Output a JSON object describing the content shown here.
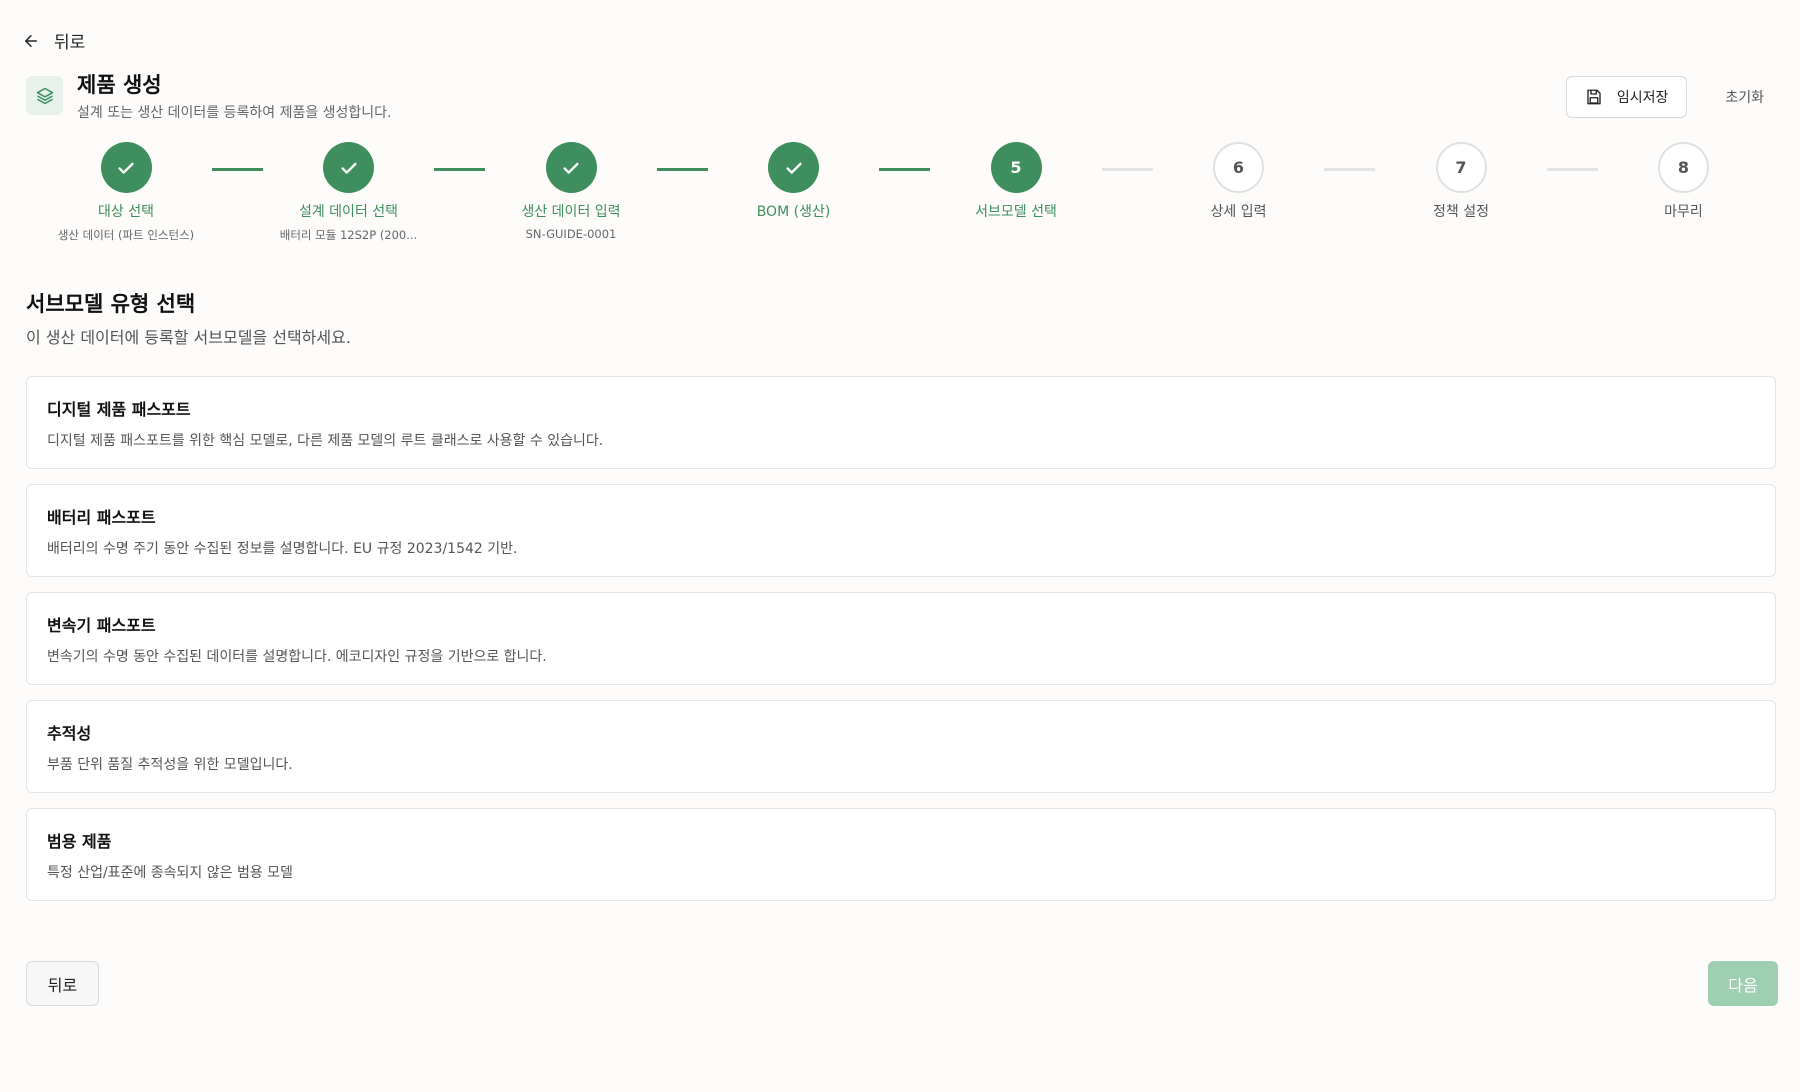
{
  "nav": {
    "back_label": "뒤로"
  },
  "header": {
    "title": "제품 생성",
    "subtitle": "설계 또는 생산 데이터를 등록하여 제품을 생성합니다.",
    "save_label": "임시저장",
    "reset_label": "초기화"
  },
  "colors": {
    "accent": "#3e8e5e",
    "accent_light": "#e8f2ec",
    "disabled_button": "#9fcfb1"
  },
  "stepper": {
    "current_step": 5,
    "steps": [
      {
        "number": "1",
        "label": "대상 선택",
        "sublabel": "생산 데이터 (파트 인스턴스)",
        "status": "done"
      },
      {
        "number": "2",
        "label": "설계 데이터 선택",
        "sublabel": "배터리 모듈 12S2P (200...",
        "status": "done"
      },
      {
        "number": "3",
        "label": "생산 데이터 입력",
        "sublabel": "SN-GUIDE-0001",
        "status": "done"
      },
      {
        "number": "4",
        "label": "BOM (생산)",
        "sublabel": "",
        "status": "done"
      },
      {
        "number": "5",
        "label": "서브모델 선택",
        "sublabel": "",
        "status": "active"
      },
      {
        "number": "6",
        "label": "상세 입력",
        "sublabel": "",
        "status": "pending"
      },
      {
        "number": "7",
        "label": "정책 설정",
        "sublabel": "",
        "status": "pending"
      },
      {
        "number": "8",
        "label": "마무리",
        "sublabel": "",
        "status": "pending"
      }
    ]
  },
  "main": {
    "section_title": "서브모델 유형 선택",
    "section_desc": "이 생산 데이터에 등록할 서브모델을 선택하세요.",
    "submodels": [
      {
        "title": "디지털 제품 패스포트",
        "desc": "디지털 제품 패스포트를 위한 핵심 모델로, 다른 제품 모델의 루트 클래스로 사용할 수 있습니다."
      },
      {
        "title": "배터리 패스포트",
        "desc": "배터리의 수명 주기 동안 수집된 정보를 설명합니다. EU 규정 2023/1542 기반."
      },
      {
        "title": "변속기 패스포트",
        "desc": "변속기의 수명 동안 수집된 데이터를 설명합니다. 에코디자인 규정을 기반으로 합니다."
      },
      {
        "title": "추적성",
        "desc": "부품 단위 품질 추적성을 위한 모델입니다."
      },
      {
        "title": "범용 제품",
        "desc": "특정 산업/표준에 종속되지 않은 범용 모델"
      }
    ]
  },
  "footer": {
    "back_label": "뒤로",
    "next_label": "다음"
  }
}
